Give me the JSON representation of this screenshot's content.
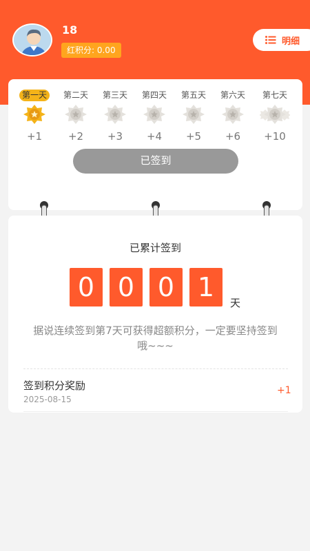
{
  "user": {
    "name": "18",
    "points_label": "红积分: 0.00"
  },
  "header": {
    "detail_label": "明细"
  },
  "checkin": {
    "days": [
      {
        "label": "第一天",
        "points": "+1",
        "active": true
      },
      {
        "label": "第二天",
        "points": "+2",
        "active": false
      },
      {
        "label": "第三天",
        "points": "+3",
        "active": false
      },
      {
        "label": "第四天",
        "points": "+4",
        "active": false
      },
      {
        "label": "第五天",
        "points": "+5",
        "active": false
      },
      {
        "label": "第六天",
        "points": "+6",
        "active": false
      },
      {
        "label": "第七天",
        "points": "+10",
        "active": false
      }
    ],
    "button_label": "已签到"
  },
  "summary": {
    "title": "已累计签到",
    "digits": [
      "0",
      "0",
      "0",
      "1"
    ],
    "unit": "天",
    "tip": "据说连续签到第7天可获得超额积分，一定要坚持签到哦~~~"
  },
  "records": [
    {
      "title": "签到积分奖励",
      "date": "2025-08-15",
      "points": "+1"
    }
  ],
  "colors": {
    "brand": "#ff5a2c",
    "badge": "#ffa51e",
    "active_day": "#f4b319",
    "button_disabled": "#999999"
  }
}
